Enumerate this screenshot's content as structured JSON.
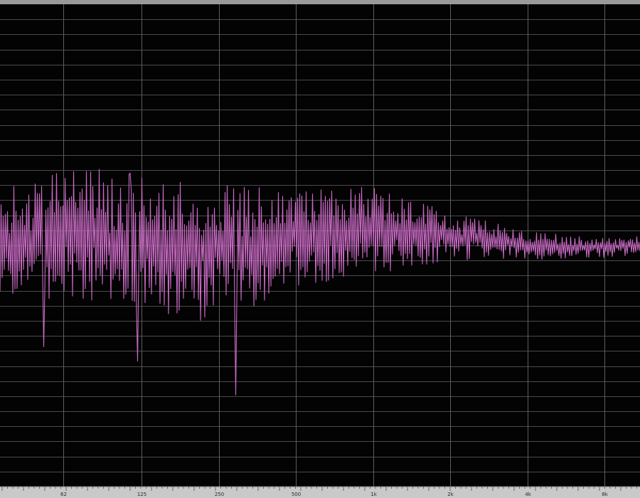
{
  "window": {
    "title": ""
  },
  "colors": {
    "background": "#030303",
    "grid": "#4b4b4b",
    "trace": "#c96ac4",
    "ruler_background": "#c9c9c9",
    "top_bar": "#9a9a9a"
  },
  "chart_data": {
    "type": "line",
    "title": "",
    "xlabel": "",
    "ylabel": "",
    "x_scale": "log",
    "xlim": [
      35,
      11000
    ],
    "ylim": [
      -1,
      1
    ],
    "grid": true,
    "x_tick_labels": [
      "62",
      "125",
      "250",
      "500",
      "1k",
      "2k",
      "4k",
      "8k"
    ],
    "x_tick_values": [
      62,
      125,
      250,
      500,
      1000,
      2000,
      4000,
      8000
    ],
    "series": [
      {
        "color": "#c96ac4",
        "style": "noisy-spectrum",
        "anchors": [
          {
            "x": 35,
            "center": 0.02,
            "spread": 0.22
          },
          {
            "x": 62,
            "center": 0.05,
            "spread": 0.28
          },
          {
            "x": 125,
            "center": 0.0,
            "spread": 0.3
          },
          {
            "x": 250,
            "center": -0.02,
            "spread": 0.3
          },
          {
            "x": 500,
            "center": 0.03,
            "spread": 0.2
          },
          {
            "x": 1000,
            "center": 0.06,
            "spread": 0.18
          },
          {
            "x": 2000,
            "center": 0.04,
            "spread": 0.1
          },
          {
            "x": 4000,
            "center": 0.0,
            "spread": 0.06
          },
          {
            "x": 8000,
            "center": -0.01,
            "spread": 0.04
          },
          {
            "x": 11000,
            "center": 0.0,
            "spread": 0.04
          }
        ],
        "peaks": [
          {
            "x": 113,
            "y": 0.3
          },
          {
            "x": 120,
            "y": -0.48
          },
          {
            "x": 290,
            "y": -0.62
          },
          {
            "x": 900,
            "y": 0.24
          },
          {
            "x": 52,
            "y": -0.42
          }
        ]
      }
    ]
  }
}
